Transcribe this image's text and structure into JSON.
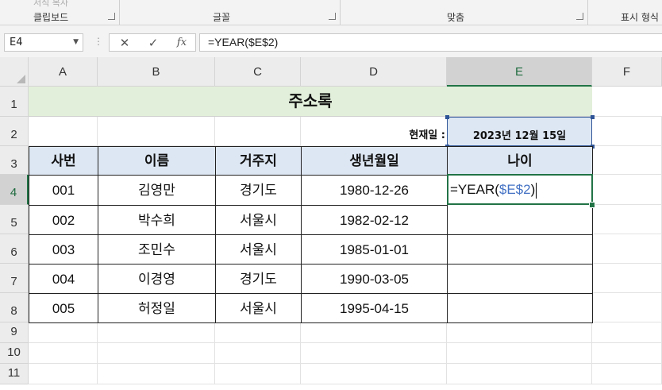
{
  "ribbon": {
    "ghost_text": "서식 복사",
    "groups": [
      "클립보드",
      "글꼴",
      "맞춤",
      "표시 형식"
    ]
  },
  "formula_bar": {
    "name_box": "E4",
    "name_dropdown_icon": "chevron-down-icon",
    "cancel_icon": "✕",
    "enter_icon": "✓",
    "fx_label": "fx",
    "formula": "=YEAR($E$2)"
  },
  "columns": [
    "A",
    "B",
    "C",
    "D",
    "E",
    "F"
  ],
  "rows": [
    "1",
    "2",
    "3",
    "4",
    "5",
    "6",
    "7",
    "8",
    "9",
    "10",
    "11"
  ],
  "selected_cell": {
    "column": "E",
    "row": "4"
  },
  "sheet": {
    "title": "주소록",
    "current_date_label": "현재일 :",
    "current_date": "2023년 12월 15일",
    "headers": [
      "사번",
      "이름",
      "거주지",
      "생년월일",
      "나이"
    ],
    "records": [
      [
        "001",
        "김영만",
        "경기도",
        "1980-12-26"
      ],
      [
        "002",
        "박수희",
        "서울시",
        "1982-02-12"
      ],
      [
        "003",
        "조민수",
        "서울시",
        "1985-01-01"
      ],
      [
        "004",
        "이경영",
        "경기도",
        "1990-03-05"
      ],
      [
        "005",
        "허정일",
        "서울시",
        "1995-04-15"
      ]
    ],
    "edit_formula_prefix": "=YEAR(",
    "edit_formula_ref": "$E$2",
    "edit_formula_suffix": ")"
  },
  "colors": {
    "title_fill": "#e2efda",
    "header_fill": "#dde7f3",
    "selection": "#217346",
    "reference": "#4472c4"
  }
}
